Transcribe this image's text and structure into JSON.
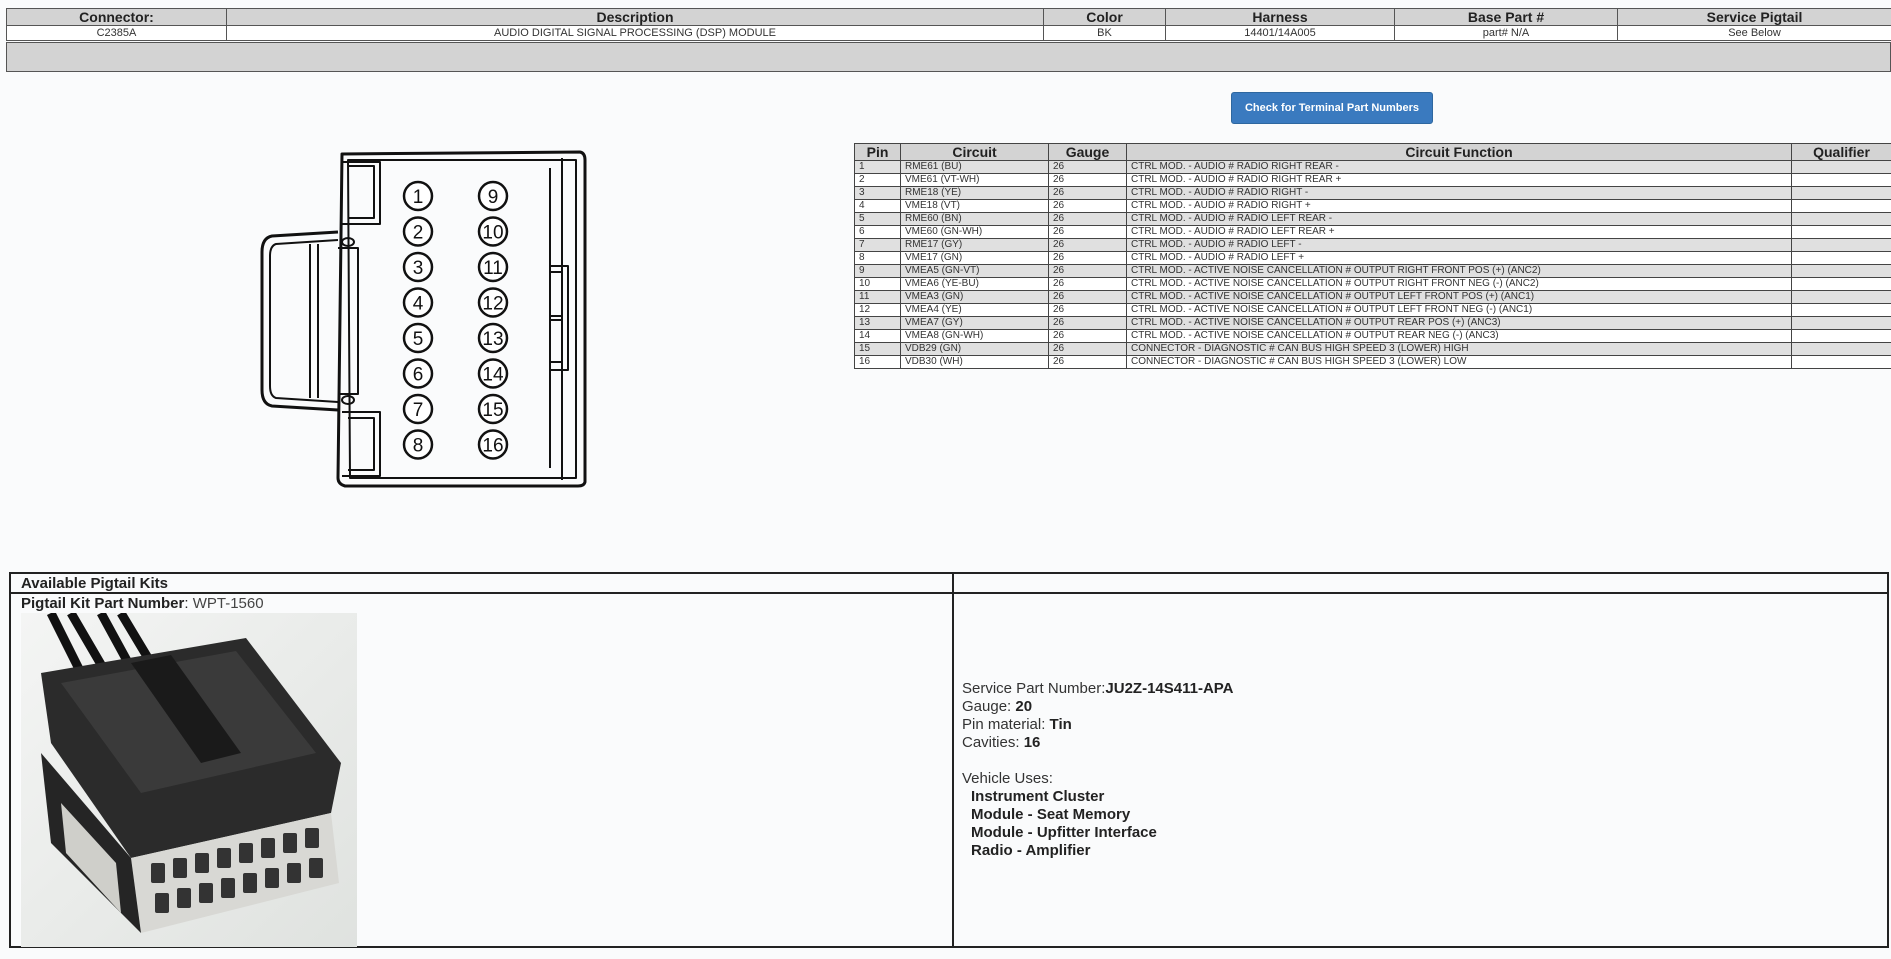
{
  "connector_header": {
    "columns": [
      "Connector:",
      "Description",
      "Color",
      "Harness",
      "Base Part #",
      "Service Pigtail"
    ],
    "values": [
      "C2385A",
      "AUDIO DIGITAL SIGNAL PROCESSING (DSP) MODULE",
      "BK",
      "14401/14A005",
      "part# N/A",
      "See Below"
    ]
  },
  "button": {
    "label": "Check for Terminal Part Numbers"
  },
  "diagram": {
    "left_pins": [
      "1",
      "2",
      "3",
      "4",
      "5",
      "6",
      "7",
      "8"
    ],
    "right_pins": [
      "9",
      "10",
      "11",
      "12",
      "13",
      "14",
      "15",
      "16"
    ]
  },
  "pin_table": {
    "headers": [
      "Pin",
      "Circuit",
      "Gauge",
      "Circuit Function",
      "Qualifier"
    ],
    "rows": [
      [
        "1",
        "RME61 (BU)",
        "26",
        "CTRL MOD. - AUDIO # RADIO RIGHT REAR -",
        ""
      ],
      [
        "2",
        "VME61 (VT-WH)",
        "26",
        "CTRL MOD. - AUDIO # RADIO RIGHT REAR +",
        ""
      ],
      [
        "3",
        "RME18 (YE)",
        "26",
        "CTRL MOD. - AUDIO # RADIO RIGHT -",
        ""
      ],
      [
        "4",
        "VME18 (VT)",
        "26",
        "CTRL MOD. - AUDIO # RADIO RIGHT +",
        ""
      ],
      [
        "5",
        "RME60 (BN)",
        "26",
        "CTRL MOD. - AUDIO # RADIO LEFT REAR -",
        ""
      ],
      [
        "6",
        "VME60 (GN-WH)",
        "26",
        "CTRL MOD. - AUDIO # RADIO LEFT REAR +",
        ""
      ],
      [
        "7",
        "RME17 (GY)",
        "26",
        "CTRL MOD. - AUDIO # RADIO LEFT -",
        ""
      ],
      [
        "8",
        "VME17 (GN)",
        "26",
        "CTRL MOD. - AUDIO # RADIO LEFT +",
        ""
      ],
      [
        "9",
        "VMEA5 (GN-VT)",
        "26",
        "CTRL MOD. - ACTIVE NOISE CANCELLATION # OUTPUT RIGHT FRONT POS (+) (ANC2)",
        ""
      ],
      [
        "10",
        "VMEA6 (YE-BU)",
        "26",
        "CTRL MOD. - ACTIVE NOISE CANCELLATION # OUTPUT RIGHT FRONT NEG (-) (ANC2)",
        ""
      ],
      [
        "11",
        "VMEA3 (GN)",
        "26",
        "CTRL MOD. - ACTIVE NOISE CANCELLATION # OUTPUT LEFT FRONT POS (+) (ANC1)",
        ""
      ],
      [
        "12",
        "VMEA4 (YE)",
        "26",
        "CTRL MOD. - ACTIVE NOISE CANCELLATION # OUTPUT LEFT FRONT NEG (-) (ANC1)",
        ""
      ],
      [
        "13",
        "VMEA7 (GY)",
        "26",
        "CTRL MOD. - ACTIVE NOISE CANCELLATION # OUTPUT REAR POS (+) (ANC3)",
        ""
      ],
      [
        "14",
        "VMEA8 (GN-WH)",
        "26",
        "CTRL MOD. - ACTIVE NOISE CANCELLATION # OUTPUT REAR NEG (-) (ANC3)",
        ""
      ],
      [
        "15",
        "VDB29 (GN)",
        "26",
        "CONNECTOR - DIAGNOSTIC # CAN BUS HIGH SPEED 3 (LOWER) HIGH",
        ""
      ],
      [
        "16",
        "VDB30 (WH)",
        "26",
        "CONNECTOR - DIAGNOSTIC # CAN BUS HIGH SPEED 3 (LOWER) LOW",
        ""
      ]
    ]
  },
  "kits": {
    "title": "Available Pigtail Kits",
    "part_label": "Pigtail Kit Part Number",
    "part_sep": ": ",
    "part_value": "WPT-1560",
    "photo_icon": "pigtail-connector-photo",
    "service_part_label": "Service Part Number:",
    "service_part_value": "JU2Z-14S411-APA",
    "gauge_label": "Gauge: ",
    "gauge_value": "20",
    "pin_material_label": "Pin material: ",
    "pin_material_value": "Tin",
    "cavities_label": "Cavities: ",
    "cavities_value": "16",
    "vehicle_uses_label": "Vehicle Uses:",
    "vehicle_uses": [
      "Instrument Cluster",
      "Module - Seat Memory",
      "Module - Upfitter Interface",
      "Radio - Amplifier"
    ]
  }
}
